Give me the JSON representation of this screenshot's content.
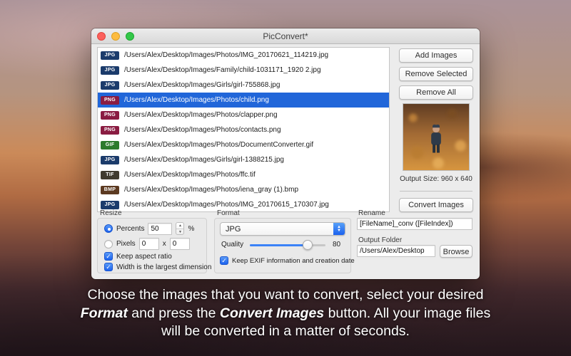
{
  "window": {
    "title": "PicConvert*"
  },
  "badge_colors": {
    "JPG": "#1b3b6b",
    "PNG": "#8a1c42",
    "GIF": "#2c7a2c",
    "TIF": "#3f3b2f",
    "BMP": "#5c3a21"
  },
  "file_list": [
    {
      "type": "JPG",
      "path": "/Users/Alex/Desktop/Images/Photos/IMG_20170621_114219.jpg",
      "selected": false
    },
    {
      "type": "JPG",
      "path": "/Users/Alex/Desktop/Images/Family/child-1031171_1920 2.jpg",
      "selected": false
    },
    {
      "type": "JPG",
      "path": "/Users/Alex/Desktop/Images/Girls/girl-755868.jpg",
      "selected": false
    },
    {
      "type": "PNG",
      "path": "/Users/Alex/Desktop/Images/Photos/child.png",
      "selected": true
    },
    {
      "type": "PNG",
      "path": "/Users/Alex/Desktop/Images/Photos/clapper.png",
      "selected": false
    },
    {
      "type": "PNG",
      "path": "/Users/Alex/Desktop/Images/Photos/contacts.png",
      "selected": false
    },
    {
      "type": "GIF",
      "path": "/Users/Alex/Desktop/Images/Photos/DocumentConverter.gif",
      "selected": false
    },
    {
      "type": "JPG",
      "path": "/Users/Alex/Desktop/Images/Girls/girl-1388215.jpg",
      "selected": false
    },
    {
      "type": "TIF",
      "path": "/Users/Alex/Desktop/Images/Photos/ffc.tif",
      "selected": false
    },
    {
      "type": "BMP",
      "path": "/Users/Alex/Desktop/Images/Photos/iena_gray (1).bmp",
      "selected": false
    },
    {
      "type": "JPG",
      "path": "/Users/Alex/Desktop/Images/Photos/IMG_20170615_170307.jpg",
      "selected": false
    }
  ],
  "right_panel": {
    "add_button": "Add Images",
    "remove_selected_button": "Remove Selected",
    "remove_all_button": "Remove All",
    "output_size": "Output Size: 960 x 640",
    "convert_button": "Convert Images"
  },
  "resize": {
    "label": "Resize",
    "percents_label": "Percents",
    "percents_value": "50",
    "percent_sign": "%",
    "pixels_label": "Pixels",
    "pixels_width": "0",
    "pixels_x": "x",
    "pixels_height": "0",
    "keep_aspect_label": "Keep aspect ratio",
    "width_largest_label": "Width is the largest dimension"
  },
  "format": {
    "label": "Format",
    "selected": "JPG",
    "quality_label": "Quality",
    "quality_value": "80",
    "exif_label": "Keep EXIF information and creation date"
  },
  "rename": {
    "label": "Rename",
    "value": "[FileName]_conv ([FileIndex])"
  },
  "output_folder": {
    "label": "Output Folder",
    "value": "/Users/Alex/Desktop",
    "browse_label": "Browse"
  },
  "caption": {
    "lines": [
      {
        "segments": [
          {
            "t": "Choose the images that you want to convert, select your desired",
            "b": false
          }
        ]
      },
      {
        "segments": [
          {
            "t": "Format",
            "b": true
          },
          {
            "t": " and press the ",
            "b": false
          },
          {
            "t": "Convert Images",
            "b": true
          },
          {
            "t": " button. All your image files",
            "b": false
          }
        ]
      },
      {
        "segments": [
          {
            "t": "will be converted in a matter of seconds.",
            "b": false
          }
        ]
      }
    ]
  }
}
